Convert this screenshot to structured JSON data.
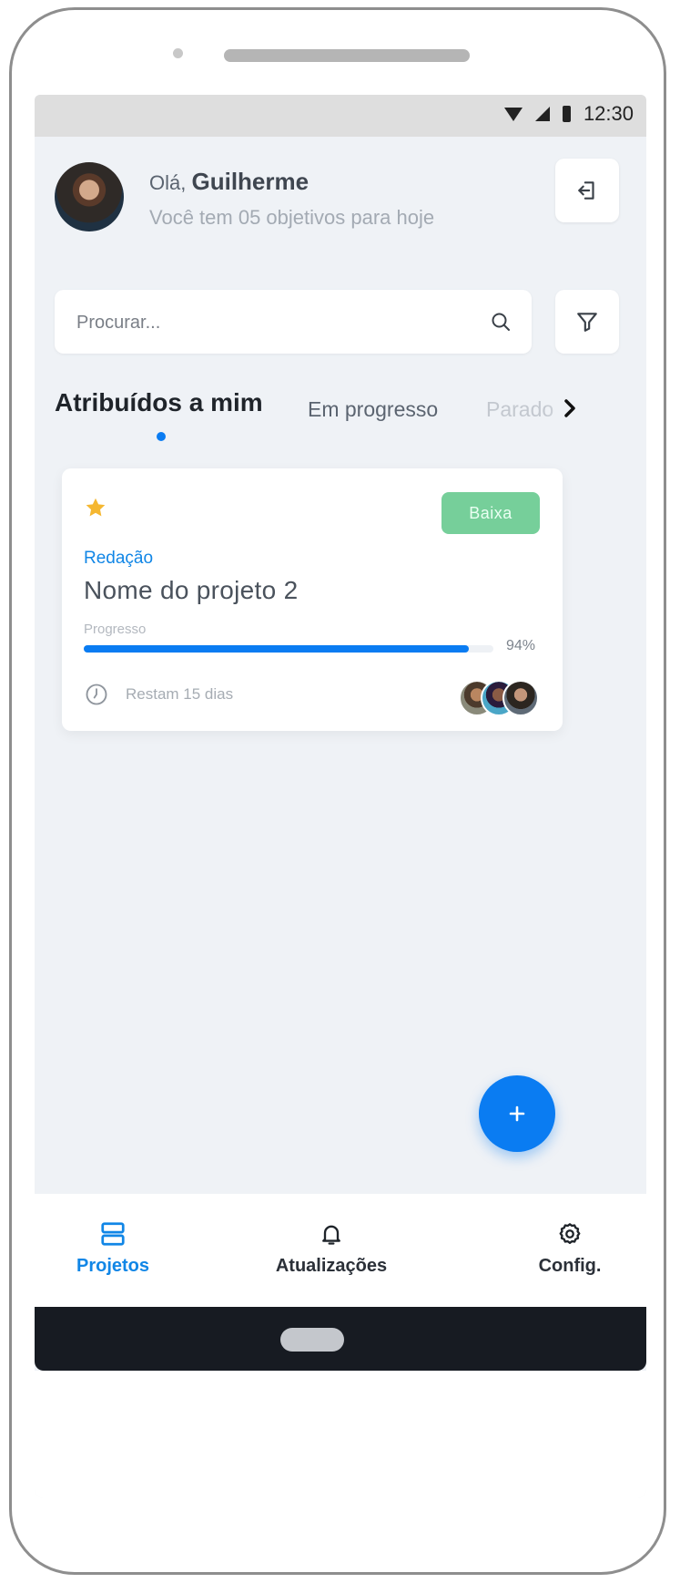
{
  "status_bar": {
    "time": "12:30"
  },
  "header": {
    "greeting_prefix": "Olá,",
    "user_name": "Guilherme",
    "subtitle": "Você tem 05 objetivos para hoje"
  },
  "search": {
    "placeholder": "Procurar..."
  },
  "tabs": [
    {
      "label": "Atribuídos a mim",
      "active": true
    },
    {
      "label": "Em progresso",
      "active": false
    },
    {
      "label": "Parado",
      "active": false
    }
  ],
  "project_card": {
    "starred": true,
    "priority": "Baixa",
    "category": "Redação",
    "title": "Nome do projeto 2",
    "progress_label": "Progresso",
    "progress_value": 94,
    "progress_text": "94%",
    "remaining": "Restam 15 dias",
    "member_count": 3
  },
  "bottom_nav": [
    {
      "label": "Projetos",
      "icon": "projects-icon",
      "active": true
    },
    {
      "label": "Atualizações",
      "icon": "bell-icon",
      "active": false
    },
    {
      "label": "Config.",
      "icon": "gear-icon",
      "active": false
    }
  ],
  "colors": {
    "accent": "#0a7cf2",
    "priority_low": "#76cf9a",
    "star": "#f5b731",
    "background": "#eff2f6"
  }
}
